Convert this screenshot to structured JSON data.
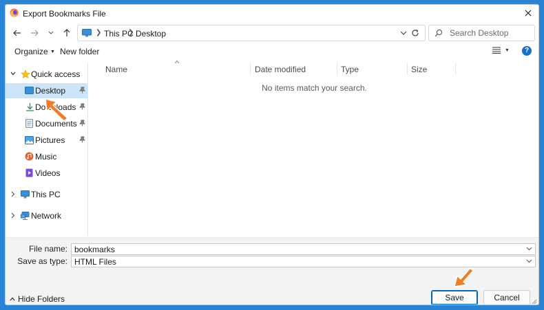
{
  "window": {
    "title": "Export Bookmarks File"
  },
  "address": {
    "crumbs": [
      "This PC",
      "Desktop"
    ]
  },
  "search": {
    "placeholder": "Search Desktop"
  },
  "toolbar": {
    "organize_label": "Organize",
    "new_folder_label": "New folder",
    "help_label": "?"
  },
  "sidebar": {
    "quick_access": "Quick access",
    "items": [
      {
        "label": "Desktop",
        "icon": "desktop-icon",
        "pinned": true
      },
      {
        "label": "Downloads",
        "icon": "download-icon",
        "pinned": true
      },
      {
        "label": "Documents",
        "icon": "documents-icon",
        "pinned": true
      },
      {
        "label": "Pictures",
        "icon": "pictures-icon",
        "pinned": true
      },
      {
        "label": "Music",
        "icon": "music-icon",
        "pinned": false
      },
      {
        "label": "Videos",
        "icon": "videos-icon",
        "pinned": false
      }
    ],
    "this_pc": "This PC",
    "network": "Network"
  },
  "columns": [
    "Name",
    "Date modified",
    "Type",
    "Size"
  ],
  "empty_message": "No items match your search.",
  "form": {
    "file_name_label": "File name:",
    "file_name_value": "bookmarks",
    "save_type_label": "Save as type:",
    "save_type_value": "HTML Files"
  },
  "footer": {
    "hide_folders_label": "Hide Folders",
    "save_label": "Save",
    "cancel_label": "Cancel"
  },
  "colors": {
    "accent": "#0067c0",
    "selection": "#cce4f7",
    "annotation_arrow": "#f07c28"
  }
}
